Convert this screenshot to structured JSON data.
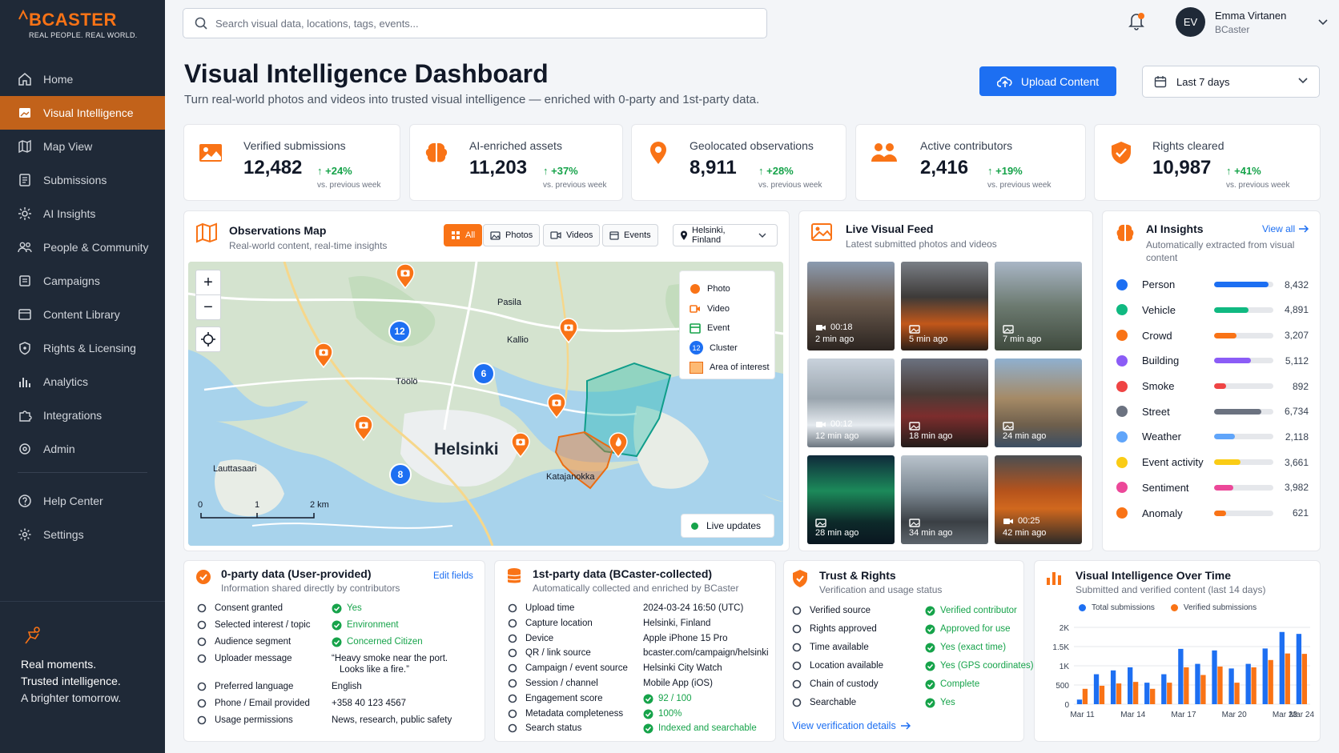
{
  "brand": {
    "name": "BCASTER",
    "tagline": "REAL PEOPLE. REAL WORLD."
  },
  "sidebar": {
    "items": [
      {
        "label": "Home",
        "icon": "home-icon"
      },
      {
        "label": "Visual Intelligence",
        "icon": "image-icon",
        "active": true
      },
      {
        "label": "Map View",
        "icon": "map-icon"
      },
      {
        "label": "Submissions",
        "icon": "document-icon"
      },
      {
        "label": "AI Insights",
        "icon": "sparkle-gear-icon"
      },
      {
        "label": "People & Community",
        "icon": "people-icon"
      },
      {
        "label": "Campaigns",
        "icon": "megaphone-icon"
      },
      {
        "label": "Content Library",
        "icon": "library-icon"
      },
      {
        "label": "Rights & Licensing",
        "icon": "shield-icon"
      },
      {
        "label": "Analytics",
        "icon": "bar-chart-icon"
      },
      {
        "label": "Integrations",
        "icon": "puzzle-icon"
      },
      {
        "label": "Admin",
        "icon": "gear-icon"
      }
    ],
    "bottom": [
      {
        "label": "Help Center",
        "icon": "help-icon"
      },
      {
        "label": "Settings",
        "icon": "settings-icon"
      }
    ],
    "promo": {
      "l1": "Real moments.",
      "l2": "Trusted intelligence.",
      "l3": "A brighter tomorrow."
    }
  },
  "topbar": {
    "search_placeholder": "Search visual data, locations, tags, events...",
    "user": {
      "initials": "EV",
      "name": "Emma Virtanen",
      "org": "BCaster"
    }
  },
  "header": {
    "title": "Visual Intelligence Dashboard",
    "subtitle": "Turn real-world photos and videos into trusted visual intelligence — enriched with 0-party and 1st-party data.",
    "upload_label": "Upload Content",
    "range_label": "Last 7 days"
  },
  "stats": [
    {
      "label": "Verified submissions",
      "value": "12,482",
      "change": "+24%",
      "vs": "vs. previous week"
    },
    {
      "label": "AI-enriched assets",
      "value": "11,203",
      "change": "+37%",
      "vs": "vs. previous week"
    },
    {
      "label": "Geolocated observations",
      "value": "8,911",
      "change": "+28%",
      "vs": "vs. previous week"
    },
    {
      "label": "Active contributors",
      "value": "2,416",
      "change": "+19%",
      "vs": "vs. previous week"
    },
    {
      "label": "Rights cleared",
      "value": "10,987",
      "change": "+41%",
      "vs": "vs. previous week"
    }
  ],
  "map": {
    "title": "Observations Map",
    "subtitle": "Real-world content, real-time insights",
    "filters": [
      "All",
      "Photos",
      "Videos",
      "Events"
    ],
    "location": "Helsinki, Finland",
    "places": {
      "city": "Helsinki",
      "pasila": "Pasila",
      "kallio": "Kallio",
      "toolo": "Töölö",
      "katajanokka": "Katajanokka",
      "lauttasaari": "Lauttasaari"
    },
    "clusters": [
      "12",
      "6",
      "8"
    ],
    "scale": {
      "a": "0",
      "b": "1",
      "c": "2 km"
    },
    "legend": [
      "Photo",
      "Video",
      "Event",
      "Cluster",
      "Area of interest"
    ],
    "legend_cluster_num": "12",
    "live_label": "Live updates"
  },
  "feed": {
    "title": "Live Visual Feed",
    "subtitle": "Latest submitted photos and videos",
    "items": [
      {
        "type": "video",
        "duration": "00:18",
        "ago": "2 min ago"
      },
      {
        "type": "photo",
        "ago": "5 min ago"
      },
      {
        "type": "photo",
        "ago": "7 min ago"
      },
      {
        "type": "video",
        "duration": "00:12",
        "ago": "12 min ago"
      },
      {
        "type": "photo",
        "ago": "18 min ago"
      },
      {
        "type": "photo",
        "ago": "24 min ago"
      },
      {
        "type": "photo",
        "ago": "28 min ago"
      },
      {
        "type": "photo",
        "ago": "34 min ago"
      },
      {
        "type": "video",
        "duration": "00:25",
        "ago": "42 min ago"
      }
    ]
  },
  "insights": {
    "title": "AI Insights",
    "view_all": "View all",
    "subtitle": "Automatically extracted from visual content",
    "items": [
      {
        "label": "Person",
        "value": "8,432",
        "ratio": 0.92,
        "color": "#1d6ff2"
      },
      {
        "label": "Vehicle",
        "value": "4,891",
        "ratio": 0.58,
        "color": "#10b981"
      },
      {
        "label": "Crowd",
        "value": "3,207",
        "ratio": 0.38,
        "color": "#f97316"
      },
      {
        "label": "Building",
        "value": "5,112",
        "ratio": 0.62,
        "color": "#8b5cf6"
      },
      {
        "label": "Smoke",
        "value": "892",
        "ratio": 0.2,
        "color": "#ef4444"
      },
      {
        "label": "Street",
        "value": "6,734",
        "ratio": 0.8,
        "color": "#6b7280"
      },
      {
        "label": "Weather",
        "value": "2,118",
        "ratio": 0.35,
        "color": "#60a5fa"
      },
      {
        "label": "Event activity",
        "value": "3,661",
        "ratio": 0.45,
        "color": "#facc15"
      },
      {
        "label": "Sentiment",
        "value": "3,982",
        "ratio": 0.33,
        "color": "#ec4899"
      },
      {
        "label": "Anomaly",
        "value": "621",
        "ratio": 0.2,
        "color": "#f97316"
      }
    ]
  },
  "zero_party": {
    "title": "0-party data (User-provided)",
    "subtitle": "Information shared directly by contributors",
    "edit": "Edit fields",
    "rows": [
      {
        "k": "Consent granted",
        "v": "Yes",
        "check": true
      },
      {
        "k": "Selected interest / topic",
        "v": "Environment",
        "check": true
      },
      {
        "k": "Audience segment",
        "v": "Concerned Citizen",
        "check": true
      },
      {
        "k": "Uploader message",
        "v": "“Heavy smoke near the port.",
        "v2": "Looks like a fire.”"
      },
      {
        "k": "Preferred language",
        "v": "English"
      },
      {
        "k": "Phone / Email provided",
        "v": "+358 40 123 4567"
      },
      {
        "k": "Usage permissions",
        "v": "News, research, public safety"
      }
    ]
  },
  "first_party": {
    "title": "1st-party data (BCaster-collected)",
    "subtitle": "Automatically collected and enriched by BCaster",
    "rows": [
      {
        "k": "Upload time",
        "v": "2024-03-24 16:50 (UTC)"
      },
      {
        "k": "Capture location",
        "v": "Helsinki, Finland"
      },
      {
        "k": "Device",
        "v": "Apple iPhone 15 Pro"
      },
      {
        "k": "QR / link source",
        "v": "bcaster.com/campaign/helsinki"
      },
      {
        "k": "Campaign / event source",
        "v": "Helsinki City Watch"
      },
      {
        "k": "Session / channel",
        "v": "Mobile App (iOS)"
      },
      {
        "k": "Engagement score",
        "v": "92 / 100",
        "check": true
      },
      {
        "k": "Metadata completeness",
        "v": "100%",
        "check": true
      },
      {
        "k": "Search status",
        "v": "Indexed and searchable",
        "check": true
      }
    ]
  },
  "trust": {
    "title": "Trust & Rights",
    "subtitle": "Verification and usage status",
    "rows": [
      {
        "k": "Verified source",
        "v": "Verified contributor"
      },
      {
        "k": "Rights approved",
        "v": "Approved for use"
      },
      {
        "k": "Time available",
        "v": "Yes (exact time)"
      },
      {
        "k": "Location available",
        "v": "Yes (GPS coordinates)"
      },
      {
        "k": "Chain of custody",
        "v": "Complete"
      },
      {
        "k": "Searchable",
        "v": "Yes"
      }
    ],
    "link": "View verification details"
  },
  "chart_data": {
    "type": "bar",
    "title": "Visual Intelligence Over Time",
    "subtitle": "Submitted and verified content (last 14 days)",
    "categories": [
      "Mar 11",
      "Mar 12",
      "Mar 13",
      "Mar 14",
      "Mar 15",
      "Mar 16",
      "Mar 17",
      "Mar 18",
      "Mar 19",
      "Mar 20",
      "Mar 21",
      "Mar 22",
      "Mar 23",
      "Mar 24"
    ],
    "tick_labels": [
      "Mar 11",
      "Mar 14",
      "Mar 17",
      "Mar 20",
      "Mar 23",
      "Mar 24"
    ],
    "series": [
      {
        "name": "Total submissions",
        "color": "#1d6ff2",
        "values": [
          120,
          780,
          880,
          960,
          560,
          780,
          1440,
          1050,
          1400,
          930,
          1050,
          1450,
          1880,
          1830
        ]
      },
      {
        "name": "Verified submissions",
        "color": "#f97316",
        "values": [
          400,
          480,
          540,
          580,
          400,
          560,
          960,
          760,
          980,
          560,
          960,
          1150,
          1320,
          1310
        ]
      }
    ],
    "ylim": [
      0,
      2000
    ],
    "yticks": [
      "0",
      "500",
      "1K",
      "1.5K",
      "2K"
    ],
    "legend": "top"
  }
}
